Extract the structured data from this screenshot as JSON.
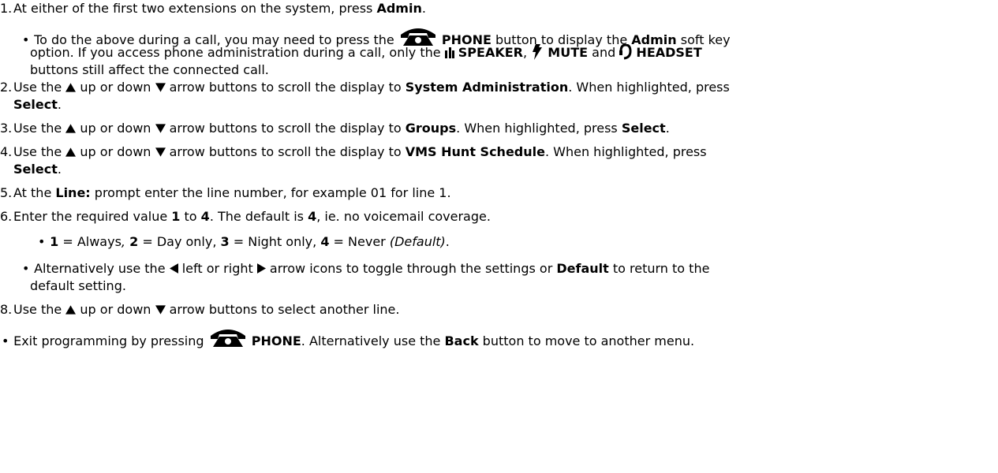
{
  "steps": {
    "s1": {
      "num": "1.",
      "pre": "At either of the first two extensions on the system, press ",
      "admin": "Admin",
      "post": "."
    },
    "b1": {
      "a": "To do the above during a call, you may need to press the ",
      "phone": "PHONE",
      "b": " button to display the ",
      "admin": "Admin",
      "c": " soft key",
      "d": "option. If you access phone administration during a call, only the ",
      "speaker": "SPEAKER",
      "comma": ",",
      "mute": "MUTE",
      "and": " and ",
      "headset": "HEADSET",
      "e": "buttons still affect the connected call."
    },
    "s2": {
      "num": "2.",
      "pre": "Use the ",
      "mid": " up or down ",
      "post": " arrow buttons to scroll the display to ",
      "target": "System Administration",
      "tail": ". When highlighted, press",
      "select": "Select",
      "dot": "."
    },
    "s3": {
      "num": "3.",
      "pre": "Use the ",
      "mid": " up or down ",
      "post": " arrow buttons to scroll the display to ",
      "target": "Groups",
      "tail": ". When highlighted, press ",
      "select": "Select",
      "dot": "."
    },
    "s4": {
      "num": "4.",
      "pre": "Use the ",
      "mid": " up or down ",
      "post": " arrow buttons to scroll the display to ",
      "target": "VMS Hunt Schedule",
      "tail": ". When highlighted, press",
      "select": "Select",
      "dot": "."
    },
    "s5": {
      "num": "5.",
      "pre": "At the ",
      "line": "Line:",
      "post": " prompt enter the line number, for example 01 for line 1."
    },
    "s6": {
      "num": "6.",
      "pre": "Enter the required value ",
      "one": "1",
      "to": " to ",
      "four": "4",
      "mid": ". The default is ",
      "def": "4",
      "post": ", ie. no voicemail coverage."
    },
    "b2": {
      "v1": "1",
      "t1": " = Always",
      "c1": ",",
      "v2": "2",
      "t2": " = Day only, ",
      "v3": "3",
      "t3": " = Night only, ",
      "v4": "4",
      "t4": " = Never ",
      "deflabel": "(Default)",
      "dot": "."
    },
    "b3": {
      "pre": "Alternatively use the ",
      "mid": " left or right ",
      "post": " arrow icons to toggle through the settings or ",
      "def": "Default",
      "tail": " to return to the",
      "line2": "default setting."
    },
    "s8": {
      "num": "8.",
      "pre": "Use the ",
      "mid": " up or down ",
      "post": " arrow buttons to select another line."
    },
    "exit": {
      "pre": "Exit programming by pressing ",
      "phone": "PHONE",
      "mid": ". Alternatively use the ",
      "back": "Back",
      "post": " button to move to another menu."
    }
  },
  "icons": {
    "phone": "phone-icon",
    "speaker": "speaker-icon",
    "mute": "mute-icon",
    "headset": "headset-icon",
    "up": "up-arrow-icon",
    "down": "down-arrow-icon",
    "left": "left-arrow-icon",
    "right": "right-arrow-icon"
  }
}
